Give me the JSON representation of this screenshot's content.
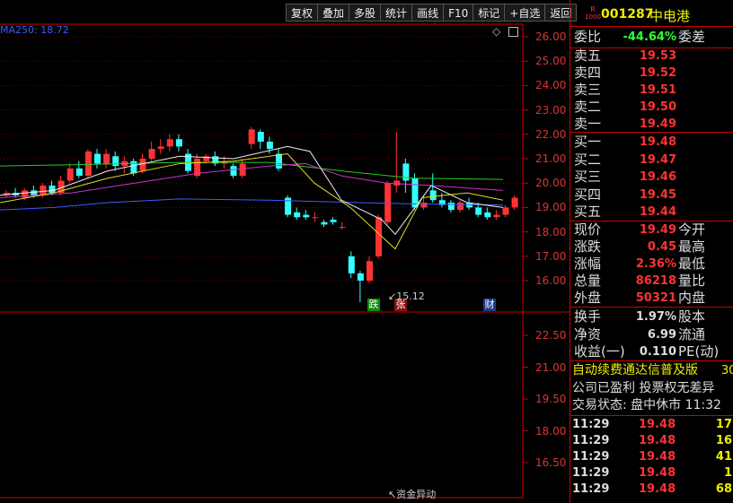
{
  "toolbar": [
    "复权",
    "叠加",
    "多股",
    "统计",
    "画线",
    "F10",
    "标记",
    "+自选",
    "返回"
  ],
  "ma_label": "MA250: 18.72",
  "price_ticks": [
    "26.00",
    "25.00",
    "24.00",
    "23.00",
    "22.00",
    "21.00",
    "20.00",
    "19.00",
    "18.00",
    "17.00",
    "16.00"
  ],
  "lower_ticks": [
    "22.50",
    "21.00",
    "19.50",
    "18.00",
    "16.50"
  ],
  "markers": [
    {
      "text": "跌",
      "bg": "#0a8a0a",
      "color": "#fff"
    },
    {
      "text": "张",
      "bg": "#8a1010",
      "color": "#fff"
    },
    {
      "text": "财",
      "bg": "#1a3a8a",
      "color": "#fff"
    }
  ],
  "low_label": "15.12",
  "fund_label": "资金异动",
  "stock": {
    "badge_top": "R",
    "badge_bottom": "1000",
    "code": "001287",
    "name": "中电港"
  },
  "ratio": {
    "label": "委比",
    "value": "-44.64%",
    "label2": "委差"
  },
  "asks": [
    {
      "label": "卖五",
      "price": "19.53"
    },
    {
      "label": "卖四",
      "price": "19.52"
    },
    {
      "label": "卖三",
      "price": "19.51"
    },
    {
      "label": "卖二",
      "price": "19.50"
    },
    {
      "label": "卖一",
      "price": "19.49"
    }
  ],
  "bids": [
    {
      "label": "买一",
      "price": "19.48"
    },
    {
      "label": "买二",
      "price": "19.47"
    },
    {
      "label": "买三",
      "price": "19.46"
    },
    {
      "label": "买四",
      "price": "19.45"
    },
    {
      "label": "买五",
      "price": "19.44"
    }
  ],
  "quote": [
    {
      "label": "现价",
      "value": "19.49",
      "label2": "今开"
    },
    {
      "label": "涨跌",
      "value": "0.45",
      "label2": "最高"
    },
    {
      "label": "涨幅",
      "value": "2.36%",
      "label2": "最低"
    },
    {
      "label": "总量",
      "value": "86218",
      "label2": "量比"
    },
    {
      "label": "外盘",
      "value": "50321",
      "label2": "内盘"
    }
  ],
  "finance": [
    {
      "label": "换手",
      "value": "1.97%",
      "label2": "股本"
    },
    {
      "label": "净资",
      "value": "6.99",
      "label2": "流通"
    },
    {
      "label": "收益(一)",
      "value": "0.110",
      "label2": "PE(动)"
    }
  ],
  "info": [
    "自动续费通达信普及版",
    "公司已盈利 投票权无差异",
    "交易状态: 盘中休市 11:32"
  ],
  "info_suffix": "30",
  "ticks_list": [
    {
      "time": "11:29",
      "price": "19.48",
      "vol": "17"
    },
    {
      "time": "11:29",
      "price": "19.48",
      "vol": "16"
    },
    {
      "time": "11:29",
      "price": "19.48",
      "vol": "41"
    },
    {
      "time": "11:29",
      "price": "19.48",
      "vol": "1"
    },
    {
      "time": "11:29",
      "price": "19.48",
      "vol": "68"
    }
  ],
  "colors": {
    "up": "#ff3333",
    "down": "#33ffff",
    "border": "#c00000",
    "ma250": "#3a5cff"
  }
}
